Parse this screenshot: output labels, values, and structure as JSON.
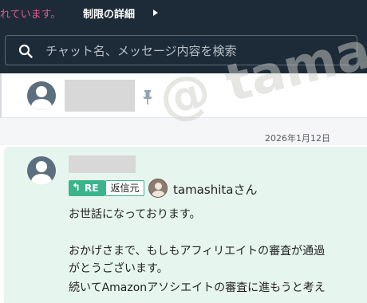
{
  "topbar": {
    "notice": "れています。",
    "detail_link": "制限の詳細"
  },
  "search": {
    "placeholder": "チャット名、メッセージ内容を検索"
  },
  "date_separator": "2026年1月12日",
  "message": {
    "re_label": "RE",
    "source_label": "返信元",
    "recipient": "tamashitaさん",
    "lines": [
      "お世話になっております。",
      "おかげさまで、もしもアフィリエイトの審査が通過",
      "がとうございます。",
      "続いてAmazonアソシエイトの審査に進もうと考え"
    ]
  },
  "watermark": "@ tama",
  "colors": {
    "topbar_bg": "#1d2b38",
    "notice_pink": "#e4578b",
    "card_bg": "#e7f5ef",
    "re_green": "#3bb48c"
  },
  "icons": [
    "search-icon",
    "pin-icon",
    "reply-arrow-icon",
    "triangle-right-icon"
  ]
}
